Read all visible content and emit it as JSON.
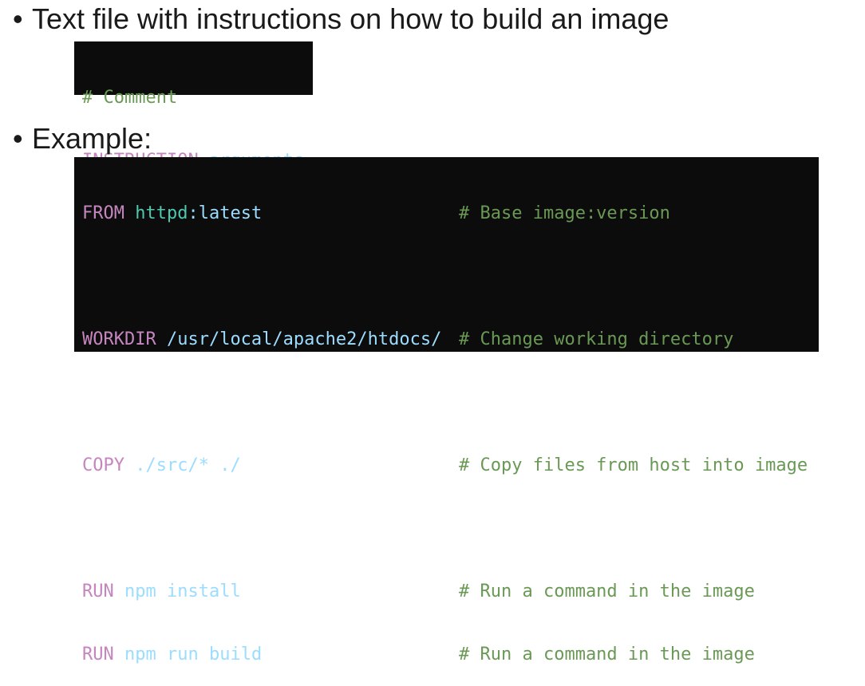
{
  "bullets": [
    {
      "dot": "•",
      "text": "Text file with instructions on how to build an image"
    },
    {
      "dot": "•",
      "text": "Example:"
    }
  ],
  "syntax_block": {
    "comment": "# Comment",
    "instruction": "INSTRUCTION",
    "arguments": "arguments"
  },
  "example_block": {
    "lines": [
      {
        "kw": "FROM",
        "arg_a": "httpd",
        "arg_sep": ":",
        "arg_b": "latest",
        "comment": "# Base image:version"
      },
      {
        "kw": "WORKDIR",
        "arg": "/usr/local/apache2/htdocs/",
        "comment": "# Change working directory"
      },
      {
        "kw": "COPY",
        "arg": "./src/* ./",
        "comment": "# Copy files from host into image"
      },
      {
        "kw": "RUN",
        "arg": "npm install",
        "comment": "# Run a command in the image"
      },
      {
        "kw": "RUN",
        "arg": "npm run build",
        "comment": "# Run a command in the image"
      }
    ]
  },
  "colors": {
    "keyword": "#c586c0",
    "argument": "#9cdcfe",
    "image_name": "#4ec9b0",
    "comment": "#6a9955",
    "code_background": "#0c0c0c"
  }
}
